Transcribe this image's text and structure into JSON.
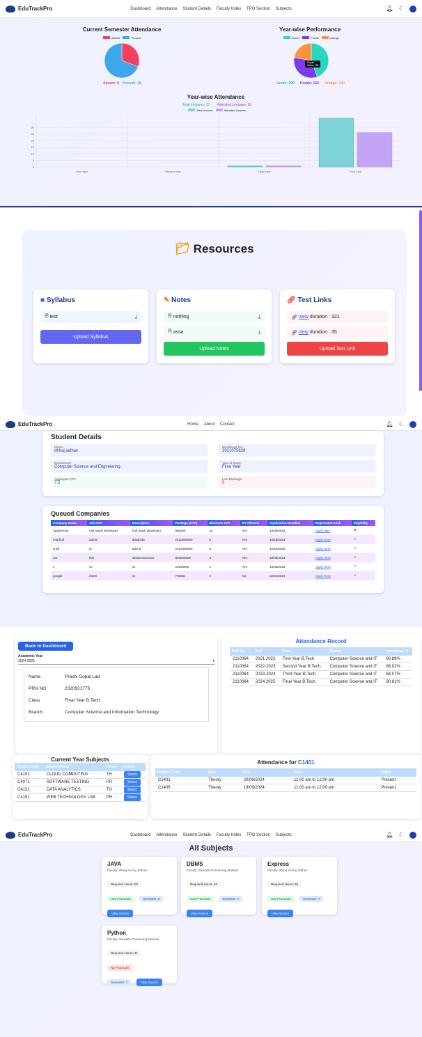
{
  "nav1": {
    "brand": "EduTrackPro",
    "links": [
      "Dashboard",
      "Attendance",
      "Student Details",
      "Faculty Index",
      "TPO Section",
      "Subjects"
    ]
  },
  "sem_chart": {
    "title": "Current Semester Attendance",
    "legend": [
      "Absent",
      "Present"
    ],
    "absent_label": "Absent: 8",
    "present_label": "Present: 18"
  },
  "year_perf": {
    "title": "Year-wise Performance",
    "legend": [
      "Green",
      "Purple",
      "Orange"
    ],
    "green_label": "Green: 200",
    "purple_label": "Purple: 150",
    "orange_label": "Orange: 100",
    "tooltip_title": "Purple",
    "tooltip_value": "Value: 150"
  },
  "year_att": {
    "title": "Year-wise Attendance",
    "total_label": "Total Lectures: 37",
    "attended_label": "Attended Lectures: 16",
    "legend": [
      "Total lectures",
      "Attended lectures"
    ]
  },
  "chart_data": [
    {
      "type": "pie",
      "title": "Current Semester Attendance",
      "labels": [
        "Absent",
        "Present"
      ],
      "values": [
        8,
        18
      ],
      "colors": [
        "#f43f5e",
        "#3ea6ea"
      ]
    },
    {
      "type": "pie",
      "title": "Year-wise Performance",
      "labels": [
        "Green",
        "Purple",
        "Orange"
      ],
      "values": [
        200,
        150,
        100
      ],
      "colors": [
        "#2dd4bf",
        "#7c3aed",
        "#fb923c"
      ]
    },
    {
      "type": "bar",
      "title": "Year-wise Attendance",
      "categories": [
        "First Year",
        "Second Year",
        "Third Year",
        "Final Year"
      ],
      "series": [
        {
          "name": "Total lectures",
          "values": [
            0,
            0,
            1,
            37
          ]
        },
        {
          "name": "Attended lectures",
          "values": [
            0,
            0,
            1,
            26
          ]
        }
      ],
      "ylim": [
        0,
        40
      ],
      "yticks": [
        0,
        5,
        10,
        15,
        20,
        25,
        30
      ]
    }
  ],
  "resources": {
    "title": "Resources",
    "syllabus": {
      "title": "Syllabus",
      "items": [
        "test"
      ],
      "button": "Upload Syllabus"
    },
    "notes": {
      "title": "Notes",
      "items": [
        "nothing",
        "assa"
      ],
      "button": "Upload Notes"
    },
    "tests": {
      "title": "Test Links",
      "items": [
        {
          "link": "view",
          "duration": "duration : 322"
        },
        {
          "link": "view",
          "duration": "duration : 35"
        }
      ],
      "button": "Upload Test Link"
    }
  },
  "nav2": {
    "brand": "EduTrackPro",
    "links": [
      "Home",
      "About",
      "Contact"
    ]
  },
  "student": {
    "title": "Student Details",
    "name_label": "Name:",
    "name": "dhiraj jadhav",
    "enroll_label": "Enrollment No:",
    "enroll": "2021075828",
    "dept_label": "Department:",
    "dept": "Computer Science and Engineering",
    "year_label": "Year of Study:",
    "year": "Final Year",
    "cgpa_label": "Aggregate CPA:",
    "cgpa": "7.5",
    "backlog_label": "Live Backlogs:",
    "backlog": "0"
  },
  "queued": {
    "title": "Queued Companies",
    "headers": [
      "Company Name",
      "Job Role",
      "Description",
      "Package (CTC)",
      "Minimum CPA",
      "KT Allowed",
      "Application Deadline",
      "Registration Link",
      "Eligibility"
    ],
    "rows": [
      [
        "Applyfrenty",
        "Full Stack Developer",
        "Full Stack Developer",
        "900000",
        "10",
        "Yes",
        "10/06/2024",
        "Apply here",
        "no"
      ],
      [
        "manholl",
        "admin",
        "dslajhsbc",
        "2410000000",
        "5",
        "Yes",
        "10/26/2024",
        "Apply Here",
        "yes"
      ],
      [
        "sneil",
        "ar",
        "adrs d",
        "2410000000",
        "5",
        "Yes",
        "10/26/2024",
        "Apply Here",
        "yes"
      ],
      [
        "zzz",
        "bsk",
        "sbsxxxxxxxxxxs",
        "800000000",
        "3",
        "Yes",
        "10/09/2024",
        "Apply Here",
        "yes"
      ],
      [
        "s",
        "ss",
        "ss",
        "22100000",
        "2",
        "Yes",
        "10/05/2024",
        "Apply Here",
        "yes"
      ],
      [
        "google",
        "intern",
        "ss",
        "709054",
        "2",
        "No",
        "10/22/2024",
        "Apply Here",
        "yes"
      ]
    ]
  },
  "dash": {
    "back": "Back to Dashboard",
    "acad_label": "Academic Year",
    "acad_value": "2024-2025",
    "info": [
      [
        "Name",
        "Prachi Gopal Lad"
      ],
      [
        "PRN NO",
        "2320921775"
      ],
      [
        "Class",
        "Final Year B.Tech."
      ],
      [
        "Branch",
        "Computer Science and Information Technology"
      ]
    ],
    "att_title": "Attendance Record",
    "att_headers": [
      "Roll No.",
      "Year",
      "Class",
      "Branch",
      "Attendance %"
    ],
    "att_rows": [
      [
        "2110064",
        "2021 2022",
        "First Year B.Tech.",
        "Computer Science and IT",
        "90.89%"
      ],
      [
        "2110064",
        "2022-2023",
        "Second Year B.Tech.",
        "Computer Science and IT",
        "86.02%"
      ],
      [
        "2110064",
        "2023-2024",
        "Third Year B.Tech.",
        "Computer Science and IT",
        "84.07%"
      ],
      [
        "2110064",
        "2024 2025",
        "Final Year B.Tech.",
        "Computer Science and IT",
        "90.81%"
      ]
    ],
    "subj_title": "Current Year Subjects",
    "subj_headers": [
      "Subject Code",
      "Subject Name",
      "Theory",
      "Action"
    ],
    "subj_rows": [
      [
        "C4101",
        "CLOUD COMPUTING",
        "TH",
        "Select"
      ],
      [
        "C4071",
        "SOFTWARE TESTING",
        "PR",
        "Select"
      ],
      [
        "C4131",
        "DATA ANALYTICS",
        "TH",
        "Select"
      ],
      [
        "C4191",
        "WEB TECHNOLOGY LAB",
        "PR",
        "Select"
      ]
    ],
    "attfor_title": "Attendance for",
    "attfor_code": "C1401",
    "attfor_headers": [
      "Subject Code",
      "Type",
      "Date",
      "Time",
      "Status"
    ],
    "attfor_rows": [
      [
        "C1401",
        "Theory",
        "20/09/2024",
        "11:00 am to 12:00 pm",
        "Present"
      ],
      [
        "C1406",
        "Theory",
        "19/09/2024",
        "11:00 am to 12:00 pm",
        "Present"
      ]
    ]
  },
  "subjects": {
    "title": "All Subjects",
    "cards": [
      {
        "name": "JAVA",
        "faculty": "Faculty: dhiraj Yuvraj Jadhav",
        "hours": "Required Hours: 50",
        "practical": "Has Practicals",
        "semester": "Semester: 6",
        "button": "View Source"
      },
      {
        "name": "DBMS",
        "faculty": "Faculty: Saurabh Pandurang Mankari",
        "hours": "Required Hours: 40",
        "practical": "Has Practicals",
        "semester": "Semester: 7",
        "button": "View Source"
      },
      {
        "name": "Express",
        "faculty": "Faculty: dhiraj Yuvraj Jadhav",
        "hours": "Required Hours: 56",
        "practical": "Has Practicals",
        "semester": "Semester: 7",
        "button": "View Source"
      },
      {
        "name": "Python",
        "faculty": "Faculty: Saurabh Pandurang Mankari",
        "hours": "Required Hours: 41",
        "practical": "No Practicals",
        "semester": "Semester: 7",
        "button": "View Source"
      }
    ]
  }
}
